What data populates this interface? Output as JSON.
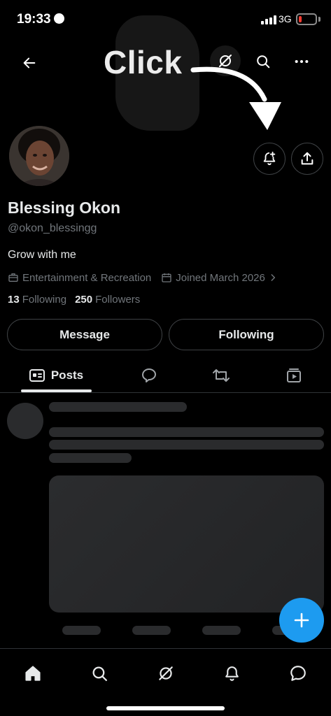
{
  "status_bar": {
    "time": "19:33",
    "network": "3G",
    "battery_level": 0.15,
    "battery_color": "#ff3b30"
  },
  "top_nav": {
    "icons": [
      "back-arrow-icon",
      "grok-icon",
      "search-icon",
      "more-icon"
    ]
  },
  "annotation": {
    "label": "Click"
  },
  "profile": {
    "name": "Blessing Okon",
    "handle": "@okon_blessingg",
    "bio": "Grow with me",
    "category": "Entertainment & Recreation",
    "joined": "Joined March 2026",
    "following_count": "13",
    "following_label": "Following",
    "followers_count": "250",
    "followers_label": "Followers"
  },
  "actions": {
    "message_label": "Message",
    "following_label": "Following"
  },
  "tabs": {
    "posts_label": "Posts",
    "icons": [
      "posts-icon",
      "replies-icon",
      "reposts-icon",
      "videos-icon"
    ]
  },
  "bottom_nav": {
    "items": [
      "home-icon",
      "search-icon",
      "grok-icon",
      "notifications-icon",
      "messages-icon"
    ]
  },
  "colors": {
    "accent": "#1d9bf0",
    "background": "#000000",
    "text_primary": "#e7e9ea",
    "text_secondary": "#71767b",
    "border": "#2f3336"
  }
}
